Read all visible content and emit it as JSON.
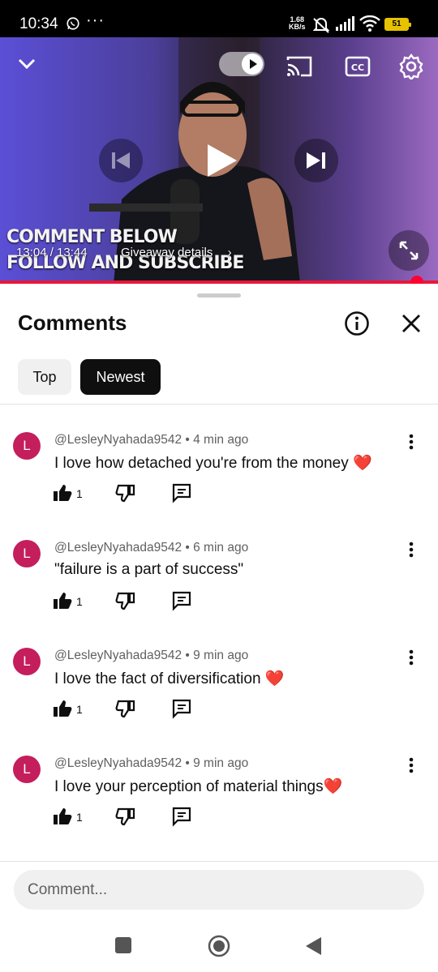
{
  "status_bar": {
    "time": "10:34",
    "net_speed_value": "1.68",
    "net_speed_unit": "KB/s",
    "battery": "51",
    "icons": [
      "whatsapp-icon",
      "more-notifications-icon",
      "silent-icon",
      "signal-icon",
      "wifi-icon",
      "battery-icon"
    ]
  },
  "player": {
    "overlay_line1": "COMMENT BELOW",
    "overlay_line2": "FOLLOW AND SUBSCRIBE",
    "time": "13:04 / 13:44",
    "giveaway_label": "Giveaway details",
    "progress_fraction": 0.951,
    "progress_color": "#ff0033"
  },
  "comments_panel": {
    "title": "Comments",
    "chips": [
      {
        "label": "Top",
        "selected": false
      },
      {
        "label": "Newest",
        "selected": true
      }
    ],
    "comments": [
      {
        "avatar_letter": "L",
        "author": "@LesleyNyahada9542",
        "age": "4 min ago",
        "text": "I love how detached you're from the money ",
        "heart": "❤️",
        "likes": "1"
      },
      {
        "avatar_letter": "L",
        "author": "@LesleyNyahada9542",
        "age": "6 min ago",
        "text": "\"failure is a part of success\"",
        "heart": "",
        "likes": "1"
      },
      {
        "avatar_letter": "L",
        "author": "@LesleyNyahada9542",
        "age": "9 min ago",
        "text": "I love the fact of diversification ",
        "heart": "❤️",
        "likes": "1"
      },
      {
        "avatar_letter": "L",
        "author": "@LesleyNyahada9542",
        "age": "9 min ago",
        "text": "I love your perception of material things",
        "heart": "❤️",
        "likes": "1"
      }
    ],
    "input_placeholder": "Comment..."
  },
  "colors": {
    "accent_red": "#ff0033",
    "avatar": "#c41e5c",
    "chip_selected": "#0f0f0f"
  }
}
